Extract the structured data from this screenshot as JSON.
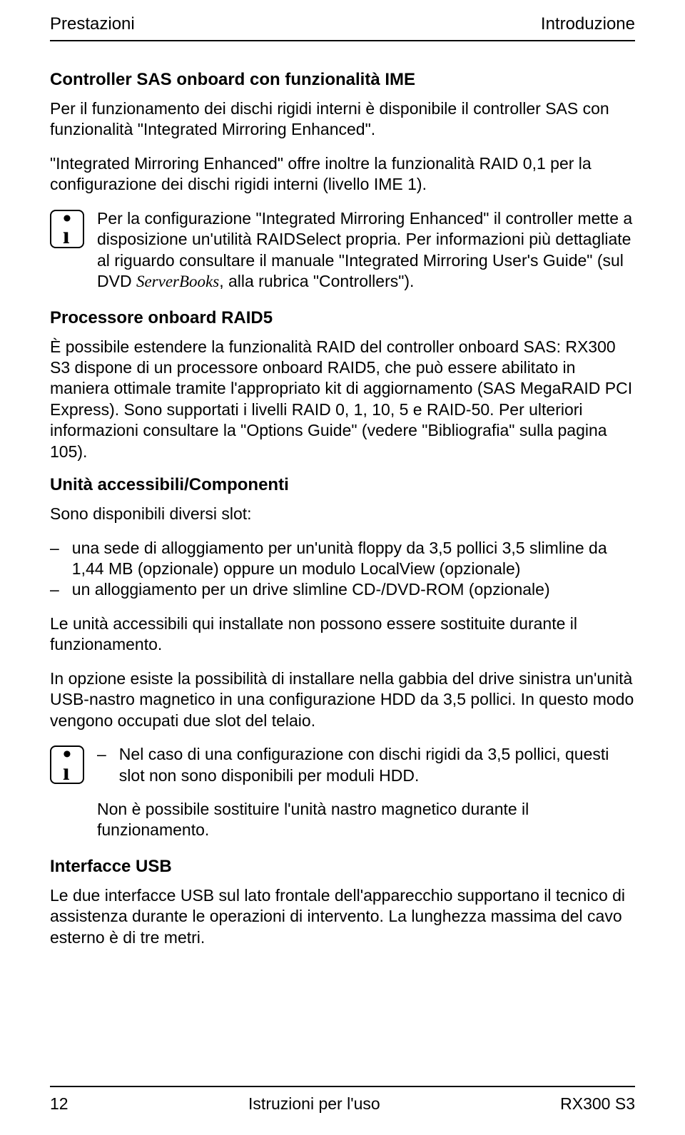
{
  "header": {
    "left": "Prestazioni",
    "right": "Introduzione"
  },
  "sec1": {
    "title": "Controller SAS onboard con funzionalità IME",
    "p1": "Per il funzionamento dei dischi rigidi interni è disponibile il controller SAS con funzionalità \"Integrated Mirroring Enhanced\".",
    "p2": "\"Integrated Mirroring Enhanced\" offre inoltre la funzionalità RAID 0,1 per la configurazione dei dischi rigidi interni (livello IME 1).",
    "info_a": "Per la configurazione \"Integrated Mirroring Enhanced\" il controller mette a disposizione un'utilità RAIDSelect propria. Per informazioni più dettagliate al riguardo consultare il manuale \"Integrated Mirroring User's Guide\" (sul DVD ",
    "info_em": "ServerBooks",
    "info_b": ", alla rubrica \"Controllers\")."
  },
  "sec2": {
    "title": "Processore onboard RAID5",
    "p1": "È possibile estendere la funzionalità RAID del controller onboard SAS: RX300 S3 dispone di un processore onboard RAID5, che può essere abilitato in maniera ottimale tramite l'appropriato kit di aggiornamento (SAS MegaRAID PCI Express). Sono supportati i livelli RAID 0, 1, 10, 5 e RAID-50. Per ulteriori informazioni consultare la \"Options Guide\" (vedere \"Bibliografia\" sulla pagina 105)."
  },
  "sec3": {
    "title": "Unità accessibili/Componenti",
    "p1": "Sono disponibili diversi slot:",
    "list": {
      "i1": "una sede di alloggiamento per un'unità floppy da 3,5 pollici 3,5 slimline da 1,44 MB (opzionale) oppure un modulo LocalView (opzionale)",
      "i2": "un alloggiamento per un drive slimline CD-/DVD-ROM (opzionale)"
    },
    "p2": "Le unità accessibili qui installate non possono essere sostituite durante il funzionamento.",
    "p3": "In opzione esiste la possibilità di installare nella gabbia del drive sinistra un'unità USB-nastro magnetico in una configurazione HDD da 3,5 pollici. In questo modo vengono occupati due slot del telaio.",
    "info_list": {
      "i1": "Nel caso di una configurazione con dischi rigidi da 3,5 pollici, questi slot non sono disponibili per moduli HDD."
    },
    "info_p": "Non è possibile sostituire l'unità nastro magnetico durante il funzionamento."
  },
  "sec4": {
    "title": "Interfacce USB",
    "p1": "Le due interfacce USB sul lato frontale dell'apparecchio supportano il tecnico di assistenza durante le operazioni di intervento. La lunghezza massima del cavo esterno è di tre metri."
  },
  "footer": {
    "page": "12",
    "center": "Istruzioni per l'uso",
    "right": "RX300 S3"
  }
}
